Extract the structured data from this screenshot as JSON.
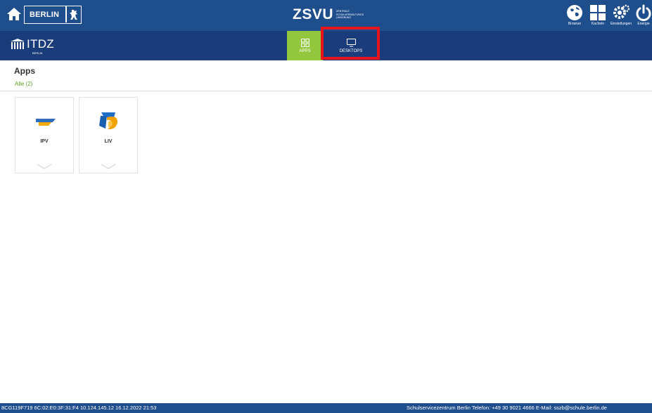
{
  "topbar": {
    "berlin_label": "BERLIN",
    "brand": "ZSVU",
    "brand_sub": "Zentrale Schulverwaltungs Umgebung",
    "icons": [
      {
        "label": "Browser",
        "icon": "globe-icon"
      },
      {
        "label": "Kacheln",
        "icon": "tiles-icon"
      },
      {
        "label": "Einstellungen",
        "icon": "gears-icon"
      },
      {
        "label": "Energie",
        "icon": "power-icon"
      }
    ]
  },
  "navbar": {
    "logo": "ITDZ",
    "logo_sub": "BERLIN",
    "tabs": [
      {
        "label": "APPS",
        "active": true
      },
      {
        "label": "DESKTOPS",
        "active": false
      }
    ],
    "accent": "#93c83e",
    "highlight_color": "#e8141c"
  },
  "content": {
    "title": "Apps",
    "filter": "Alle (2)",
    "apps": [
      {
        "name": "IPV",
        "icon": "ipv-icon"
      },
      {
        "name": "LIV",
        "icon": "liv-icon"
      }
    ]
  },
  "footer": {
    "left": "8CG119F719  6C:02:E0:3F:31:F4  10.124.145.12  16.12.2022  21:53",
    "right": "Schulservicezentrum Berlin   Telefon: +49 30 9021 4666   E-Mail: sszb@schule.berlin.de"
  }
}
